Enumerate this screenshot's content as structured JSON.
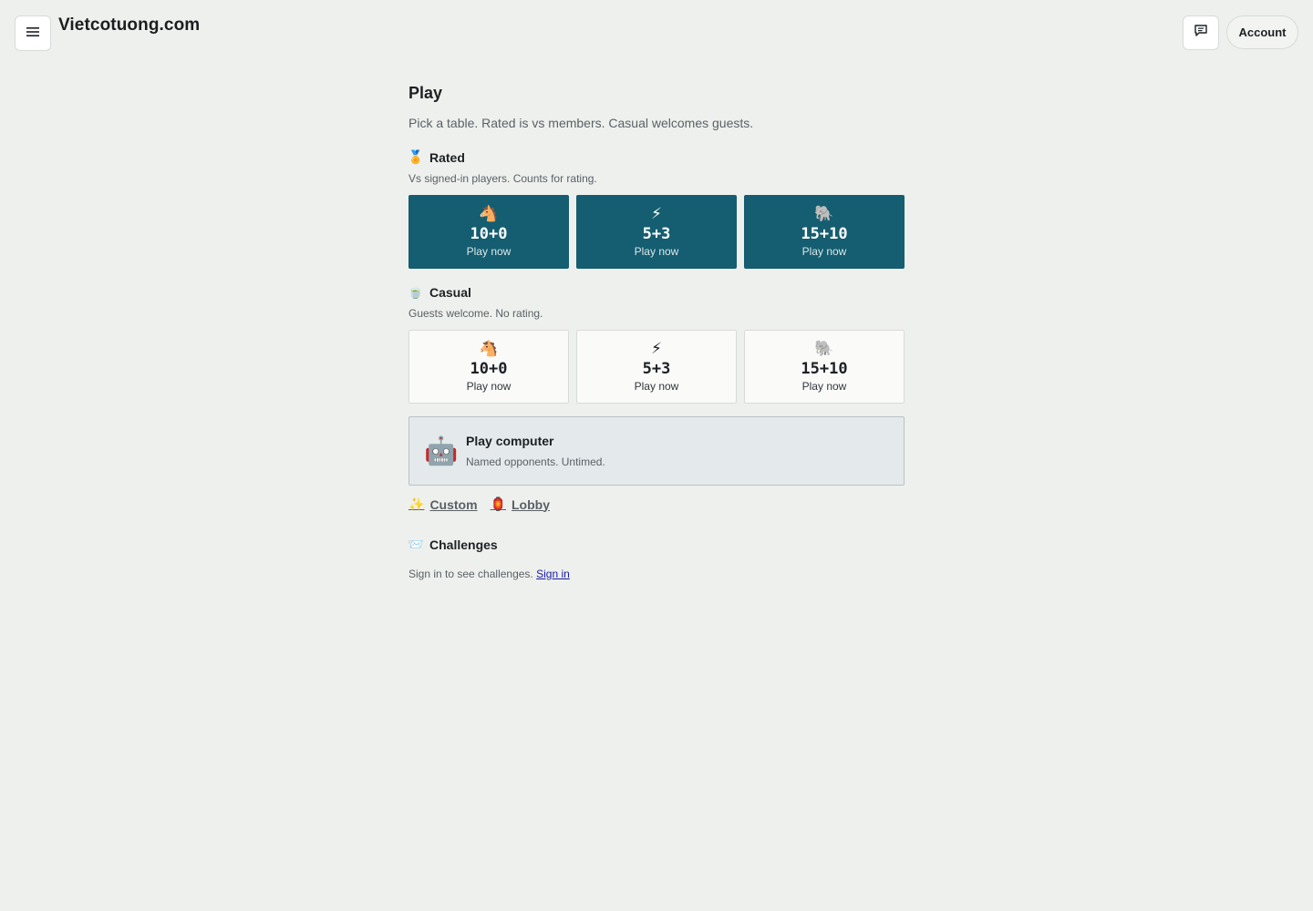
{
  "header": {
    "site_title": "Vietcotuong.com",
    "account_label": "Account",
    "menu_icon": "menu-icon",
    "chat_icon": "chat-icon"
  },
  "main": {
    "title": "Play",
    "subtitle": "Pick a table. Rated is vs members. Casual welcomes guests."
  },
  "rated": {
    "emoji": "🏅",
    "heading": "Rated",
    "subtitle": "Vs signed-in players. Counts for rating.",
    "tiles": [
      {
        "icon": "🐴",
        "time": "10+0",
        "label": "Play now"
      },
      {
        "icon": "⚡",
        "time": "5+3",
        "label": "Play now"
      },
      {
        "icon": "🐘",
        "time": "15+10",
        "label": "Play now"
      }
    ]
  },
  "casual": {
    "emoji": "🍵",
    "heading": "Casual",
    "subtitle": "Guests welcome. No rating.",
    "tiles": [
      {
        "icon": "🐴",
        "time": "10+0",
        "label": "Play now"
      },
      {
        "icon": "⚡",
        "time": "5+3",
        "label": "Play now"
      },
      {
        "icon": "🐘",
        "time": "15+10",
        "label": "Play now"
      }
    ]
  },
  "computer": {
    "icon": "🤖",
    "title": "Play computer",
    "subtitle": "Named opponents. Untimed."
  },
  "links": {
    "custom_emoji": "✨",
    "custom_label": "Custom",
    "lobby_emoji": "🏮",
    "lobby_label": "Lobby"
  },
  "challenges": {
    "emoji": "📨",
    "heading": "Challenges",
    "text": "Sign in to see challenges.",
    "signin_label": "Sign in"
  },
  "colors": {
    "background": "#eef0ed",
    "rated_tile": "#155d70",
    "link": "#1a1aa6"
  }
}
